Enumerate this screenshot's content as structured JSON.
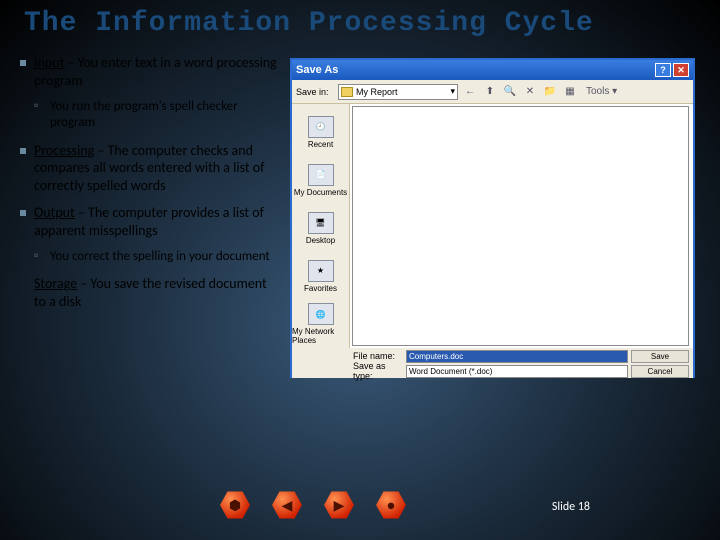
{
  "title": "The Information Processing Cycle",
  "bullets": {
    "input_label": "Input",
    "input_text": " – You enter text in a word processing program",
    "input_sub": "You run the program's spell checker program",
    "processing_label": "Processing",
    "processing_text": " – The computer checks and compares all words entered with a list of correctly spelled words",
    "output_label": "Output",
    "output_text": " – The computer provides a list of apparent misspellings",
    "output_sub": "You correct the spelling in your document",
    "storage_label": "Storage",
    "storage_text": " – You save the revised document to a disk"
  },
  "dialog": {
    "title": "Save As",
    "help_glyph": "?",
    "close_glyph": "✕",
    "savein_label": "Save in:",
    "folder_name": "My Report",
    "back_glyph": "←",
    "up_glyph": "⬆",
    "search_glyph": "🔍",
    "delete_glyph": "✕",
    "newfolder_glyph": "📁",
    "views_glyph": "▦",
    "tools_label": "Tools ▾",
    "places": {
      "recent": "Recent",
      "mydocs": "My Documents",
      "desktop": "Desktop",
      "favorites": "Favorites",
      "network": "My Network Places"
    },
    "filename_label": "File name:",
    "filename_value": "Computers.doc",
    "filetype_label": "Save as type:",
    "filetype_value": "Word Document (*.doc)",
    "save_btn": "Save",
    "cancel_btn": "Cancel"
  },
  "nav": {
    "home": "⬢",
    "prev": "◀",
    "next": "▶",
    "last": "●"
  },
  "slide_label": "Slide 18"
}
